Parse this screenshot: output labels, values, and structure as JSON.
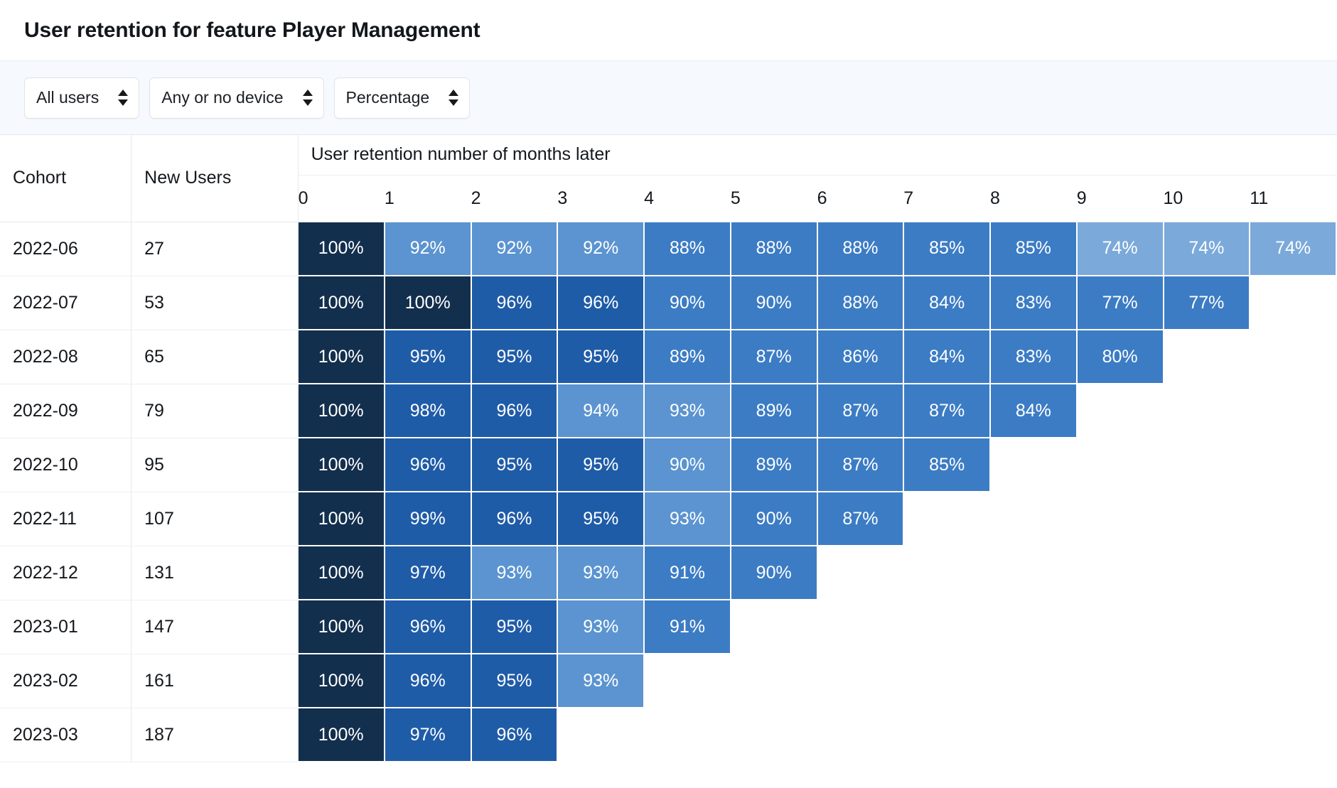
{
  "header": {
    "title": "User retention for feature Player Management"
  },
  "filters": [
    {
      "name": "user-segment",
      "value": "All users"
    },
    {
      "name": "device",
      "value": "Any or no device"
    },
    {
      "name": "display-mode",
      "value": "Percentage"
    }
  ],
  "table": {
    "col_cohort_label": "Cohort",
    "col_new_users_label": "New Users",
    "group_header": "User retention number of months later",
    "month_headers": [
      "0",
      "1",
      "2",
      "3",
      "4",
      "5",
      "6",
      "7",
      "8",
      "9",
      "10",
      "11"
    ]
  },
  "chart_data": {
    "type": "heatmap",
    "title": "User retention for feature Player Management",
    "xlabel": "User retention number of months later",
    "ylabel": "Cohort",
    "value_format": "percent",
    "legend": "none",
    "x_categories": [
      "0",
      "1",
      "2",
      "3",
      "4",
      "5",
      "6",
      "7",
      "8",
      "9",
      "10",
      "11"
    ],
    "y_categories": [
      "2022-06",
      "2022-07",
      "2022-08",
      "2022-09",
      "2022-10",
      "2022-11",
      "2022-12",
      "2023-01",
      "2023-02",
      "2023-03"
    ],
    "new_users": [
      27,
      53,
      65,
      79,
      95,
      107,
      131,
      147,
      161,
      187
    ],
    "colors": {
      "darkest": "#132f4e",
      "dark": "#1f5ca8",
      "mid": "#3c7cc4",
      "light": "#5b94d0",
      "lighter": "#7ba9da",
      "text": "#ffffff"
    },
    "rows": [
      {
        "cohort": "2022-06",
        "new_users": 27,
        "values": [
          "100%",
          "92%",
          "92%",
          "92%",
          "88%",
          "88%",
          "88%",
          "85%",
          "85%",
          "74%",
          "74%",
          "74%"
        ],
        "shades": [
          "darkest",
          "light",
          "light",
          "light",
          "mid",
          "mid",
          "mid",
          "mid",
          "mid",
          "lighter",
          "lighter",
          "lighter"
        ]
      },
      {
        "cohort": "2022-07",
        "new_users": 53,
        "values": [
          "100%",
          "100%",
          "96%",
          "96%",
          "90%",
          "90%",
          "88%",
          "84%",
          "83%",
          "77%",
          "77%"
        ],
        "shades": [
          "darkest",
          "darkest",
          "dark",
          "dark",
          "mid",
          "mid",
          "mid",
          "mid",
          "mid",
          "mid",
          "mid"
        ]
      },
      {
        "cohort": "2022-08",
        "new_users": 65,
        "values": [
          "100%",
          "95%",
          "95%",
          "95%",
          "89%",
          "87%",
          "86%",
          "84%",
          "83%",
          "80%"
        ],
        "shades": [
          "darkest",
          "dark",
          "dark",
          "dark",
          "mid",
          "mid",
          "mid",
          "mid",
          "mid",
          "mid"
        ]
      },
      {
        "cohort": "2022-09",
        "new_users": 79,
        "values": [
          "100%",
          "98%",
          "96%",
          "94%",
          "93%",
          "89%",
          "87%",
          "87%",
          "84%"
        ],
        "shades": [
          "darkest",
          "dark",
          "dark",
          "light",
          "light",
          "mid",
          "mid",
          "mid",
          "mid"
        ]
      },
      {
        "cohort": "2022-10",
        "new_users": 95,
        "values": [
          "100%",
          "96%",
          "95%",
          "95%",
          "90%",
          "89%",
          "87%",
          "85%"
        ],
        "shades": [
          "darkest",
          "dark",
          "dark",
          "dark",
          "light",
          "mid",
          "mid",
          "mid"
        ]
      },
      {
        "cohort": "2022-11",
        "new_users": 107,
        "values": [
          "100%",
          "99%",
          "96%",
          "95%",
          "93%",
          "90%",
          "87%"
        ],
        "shades": [
          "darkest",
          "dark",
          "dark",
          "dark",
          "light",
          "mid",
          "mid"
        ]
      },
      {
        "cohort": "2022-12",
        "new_users": 131,
        "values": [
          "100%",
          "97%",
          "93%",
          "93%",
          "91%",
          "90%"
        ],
        "shades": [
          "darkest",
          "dark",
          "light",
          "light",
          "mid",
          "mid"
        ]
      },
      {
        "cohort": "2023-01",
        "new_users": 147,
        "values": [
          "100%",
          "96%",
          "95%",
          "93%",
          "91%"
        ],
        "shades": [
          "darkest",
          "dark",
          "dark",
          "light",
          "mid"
        ]
      },
      {
        "cohort": "2023-02",
        "new_users": 161,
        "values": [
          "100%",
          "96%",
          "95%",
          "93%"
        ],
        "shades": [
          "darkest",
          "dark",
          "dark",
          "light"
        ]
      },
      {
        "cohort": "2023-03",
        "new_users": 187,
        "values": [
          "100%",
          "97%",
          "96%"
        ],
        "shades": [
          "darkest",
          "dark",
          "dark"
        ]
      }
    ]
  }
}
